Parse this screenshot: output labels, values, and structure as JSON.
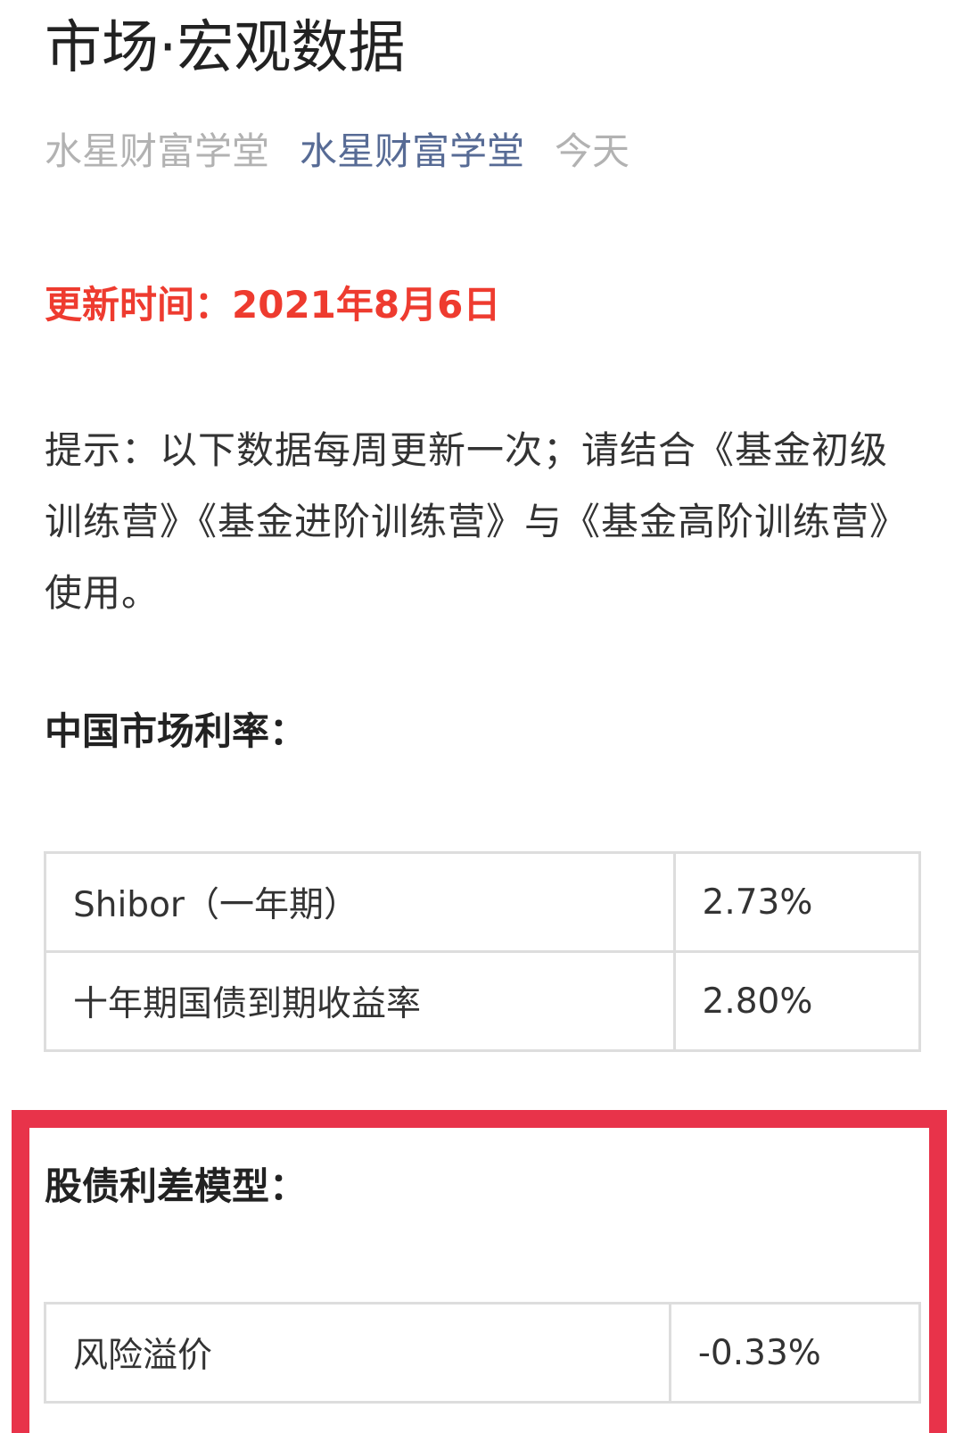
{
  "article": {
    "title": "市场·宏观数据",
    "author": "水星财富学堂",
    "account": "水星财富学堂",
    "date": "今天"
  },
  "update_notice": "更新时间：2021年8月6日",
  "hint": "提示：以下数据每周更新一次；请结合《基金初级训练营》《基金进阶训练营》与《基金高阶训练营》使用。",
  "china_rates": {
    "heading": "中国市场利率：",
    "rows": [
      {
        "name": "Shibor（一年期）",
        "value": "2.73%"
      },
      {
        "name": "十年期国债到期收益率",
        "value": "2.80%"
      }
    ]
  },
  "equity_bond_spread": {
    "heading": "股债利差模型：",
    "rows": [
      {
        "name": "风险溢价",
        "value": "-0.33%"
      }
    ]
  },
  "colors": {
    "update_red": "#ee3b2f",
    "account_blue": "#576b95",
    "highlight_border": "#e8334a"
  }
}
